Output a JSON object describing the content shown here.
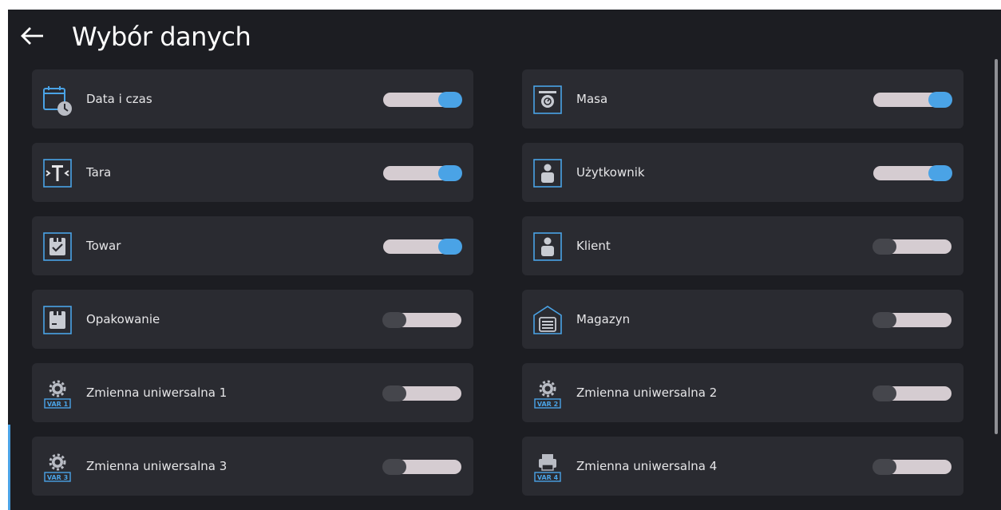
{
  "header": {
    "title": "Wybór danych"
  },
  "items": [
    {
      "label": "Data i czas",
      "icon": "calendar-clock-icon",
      "enabled": true
    },
    {
      "label": "Masa",
      "icon": "scale-icon",
      "enabled": true
    },
    {
      "label": "Tara",
      "icon": "tare-icon",
      "enabled": true
    },
    {
      "label": "Użytkownik",
      "icon": "user-icon",
      "enabled": true
    },
    {
      "label": "Towar",
      "icon": "product-icon",
      "enabled": true
    },
    {
      "label": "Klient",
      "icon": "client-icon",
      "enabled": false
    },
    {
      "label": "Opakowanie",
      "icon": "packaging-icon",
      "enabled": false
    },
    {
      "label": "Magazyn",
      "icon": "warehouse-icon",
      "enabled": false
    },
    {
      "label": "Zmienna uniwersalna 1",
      "icon": "universal-variable-icon",
      "badge": "VAR 1",
      "enabled": false
    },
    {
      "label": "Zmienna uniwersalna 2",
      "icon": "universal-variable-icon",
      "badge": "VAR 2",
      "enabled": false
    },
    {
      "label": "Zmienna uniwersalna 3",
      "icon": "universal-variable-icon",
      "badge": "VAR 3",
      "enabled": false
    },
    {
      "label": "Zmienna uniwersalna 4",
      "icon": "printer-variable-icon",
      "badge": "VAR 4",
      "enabled": false
    }
  ],
  "colors": {
    "accent": "#4aa3e6",
    "background": "#1c1d22",
    "card": "#2a2b31",
    "toggle_track": "#d5ccd1"
  }
}
